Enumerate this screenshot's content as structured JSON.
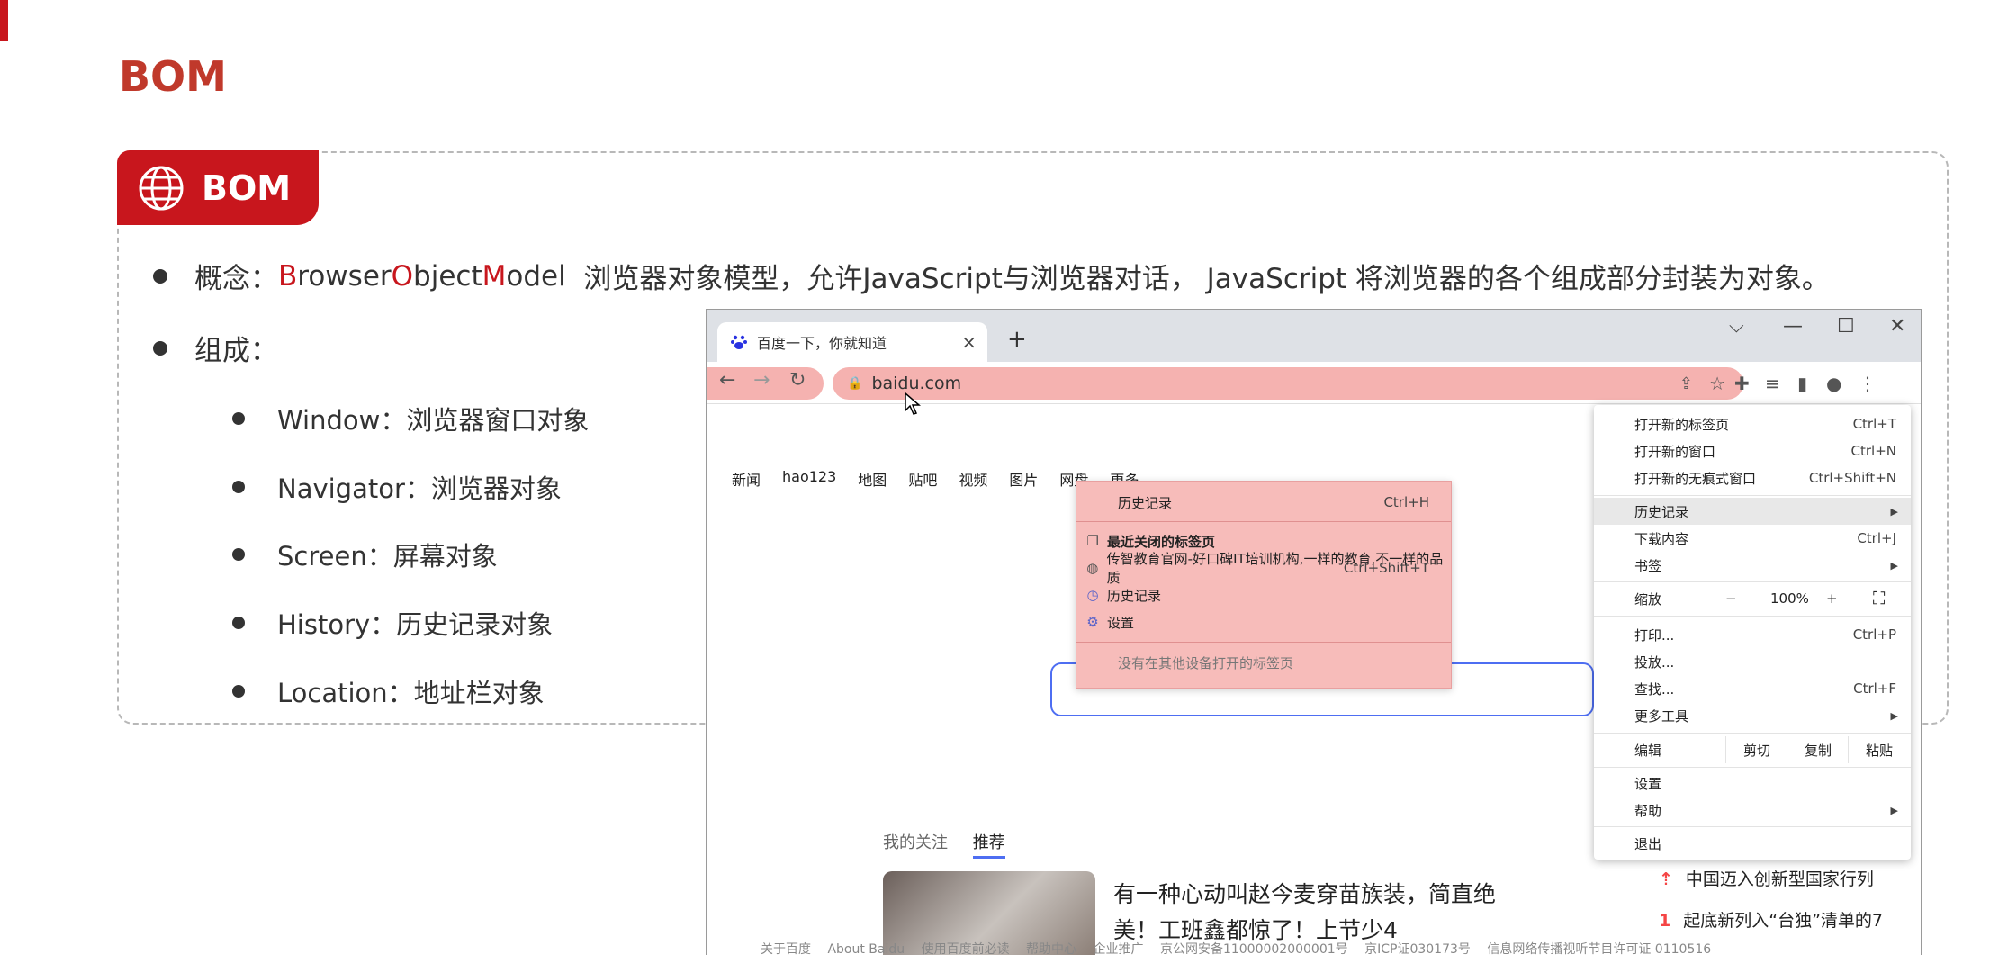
{
  "slide": {
    "title": "BOM",
    "header_label": "BOM",
    "concept": {
      "prefix": "概念：",
      "b": "B",
      "rowser": "rowser ",
      "o": "O",
      "bject": "bject ",
      "m": "M",
      "odel": "odel",
      "rest": "  浏览器对象模型，允许JavaScript与浏览器对话， JavaScript 将浏览器的各个组成部分封装为对象。"
    },
    "composition_label": "组成：",
    "components": [
      "Window：浏览器窗口对象",
      "Navigator：浏览器对象",
      "Screen：屏幕对象",
      "History：历史记录对象",
      "Location：地址栏对象"
    ]
  },
  "browser": {
    "tab_title": "百度一下，你就知道",
    "tab_close": "×",
    "new_tab": "+",
    "win_min": "—",
    "win_max": "☐",
    "win_close": "✕",
    "win_dropdown": "⌵",
    "url": "baidu.com",
    "nav": [
      "新闻",
      "hao123",
      "地图",
      "贴吧",
      "视频",
      "图片",
      "网盘",
      "更多"
    ],
    "feed_tabs": {
      "follow": "我的关注",
      "recommend": "推荐"
    },
    "headline": "有一种心动叫赵今麦穿苗族装，简直绝美！工班鑫都惊了！上节少4",
    "hot_list": [
      {
        "num": "⇡",
        "text": "中国迈入创新型国家行列"
      },
      {
        "num": "1",
        "text": "起底新列入“台独”清单的7"
      }
    ],
    "footer": [
      "关于百度",
      "About Baidu",
      "使用百度前必读",
      "帮助中心",
      "企业推广",
      "京公网安备11000002000001号",
      "京ICP证030173号",
      "信息网络传播视听节目许可证 0110516"
    ]
  },
  "history_menu": {
    "title": "历史记录",
    "title_shortcut": "Ctrl+H",
    "recent_closed": "最近关闭的标签页",
    "item_site": "传智教育官网-好口碑IT培训机构,一样的教育,不一样的品质",
    "item_site_shortcut": "Ctrl+Shift+T",
    "item_history": "历史记录",
    "item_settings": "设置",
    "no_devices": "没有在其他设备打开的标签页"
  },
  "main_menu": {
    "new_tab": "打开新的标签页",
    "new_tab_sc": "Ctrl+T",
    "new_window": "打开新的窗口",
    "new_window_sc": "Ctrl+N",
    "incognito": "打开新的无痕式窗口",
    "incognito_sc": "Ctrl+Shift+N",
    "history": "历史记录",
    "downloads": "下载内容",
    "downloads_sc": "Ctrl+J",
    "bookmarks": "书签",
    "zoom": "缩放",
    "zoom_minus": "−",
    "zoom_value": "100%",
    "zoom_plus": "+",
    "print": "打印...",
    "print_sc": "Ctrl+P",
    "cast": "投放...",
    "find": "查找...",
    "find_sc": "Ctrl+F",
    "more_tools": "更多工具",
    "edit": "编辑",
    "cut": "剪切",
    "copy": "复制",
    "paste": "粘贴",
    "settings": "设置",
    "help": "帮助",
    "exit": "退出"
  },
  "colors": {
    "accent": "#c8161d",
    "highlight": "#f5b2b0"
  }
}
